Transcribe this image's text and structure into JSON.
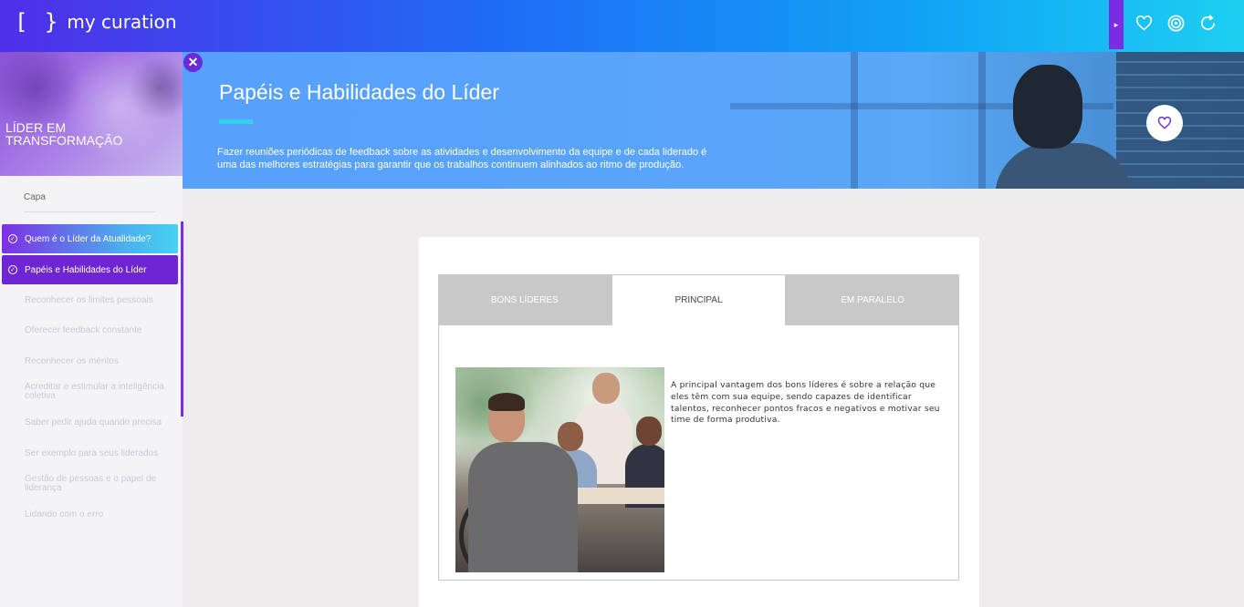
{
  "app": {
    "logo_brackets": "[ }",
    "logo_text": "my curation"
  },
  "topbar": {
    "icons": [
      "heart-outline-icon",
      "target-icon",
      "refresh-icon"
    ],
    "panel_toggle_glyph": "▸"
  },
  "sidebar": {
    "course_title": "LÍDER EM TRANSFORMAÇÃO",
    "capa_label": "Capa",
    "completed_items": [
      {
        "label": "Quem é o Líder da Atualidade?"
      },
      {
        "label": "Papéis e Habilidades do Líder"
      }
    ],
    "items": [
      {
        "label": "Reconhecer os limites pessoais"
      },
      {
        "label": "Oferecer feedback constante"
      },
      {
        "label": "Reconhecer os méritos"
      },
      {
        "label": "Acreditar e estimular a inteligência coletiva"
      },
      {
        "label": "Saber pedir ajuda quando precisa"
      },
      {
        "label": "Ser exemplo para seus liderados"
      },
      {
        "label": "Gestão de pessoas e o papel de liderança"
      },
      {
        "label": "Lidando com o erro"
      }
    ]
  },
  "banner": {
    "title": "Papéis e Habilidades do Líder",
    "description": "Fazer reuniões periódicas de feedback sobre as atividades e desenvolvimento da equipe e de cada liderado é uma das melhores estratégias para garantir que os trabalhos continuem alinhados ao ritmo de produção."
  },
  "tabs": [
    {
      "label": "BONS LÍDERES",
      "active": false
    },
    {
      "label": "PRINCIPAL",
      "active": true
    },
    {
      "label": "EM PARALELO",
      "active": false
    }
  ],
  "panel": {
    "text": "A principal vantagem dos bons líderes é sobre a relação que eles têm com sua equipe, sendo capazes de identificar talentos, reconhecer pontos fracos e negativos e motivar seu time de forma produtiva."
  },
  "colors": {
    "accent_purple": "#6e26d4",
    "accent_cyan": "#33d0f0",
    "banner_blue": "#57a0fb"
  }
}
